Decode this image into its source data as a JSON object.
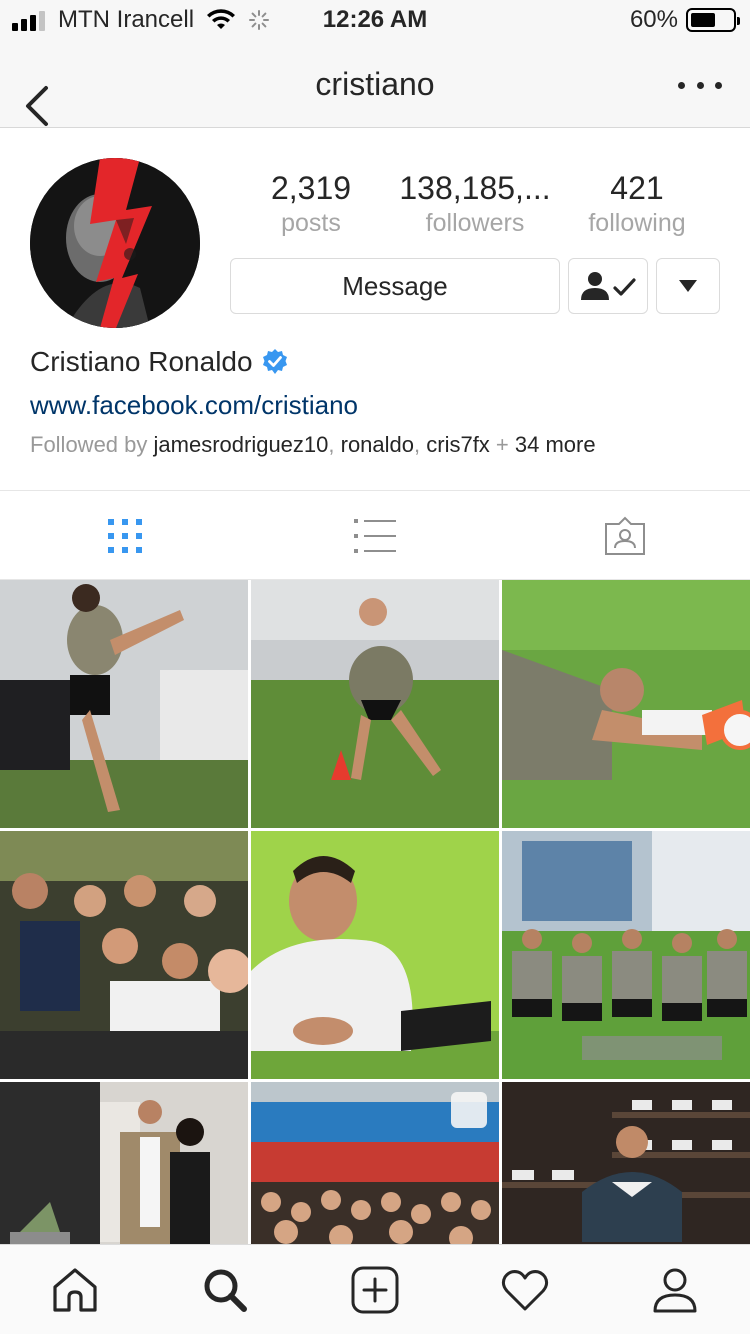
{
  "status_bar": {
    "carrier": "MTN Irancell",
    "time": "12:26 AM",
    "battery": "60%",
    "battery_level": 0.6,
    "signal_bars_filled": 3,
    "signal_bars_total": 4
  },
  "nav": {
    "title": "cristiano",
    "back_icon": "chevron-left-icon",
    "more_icon": "more-horizontal-icon"
  },
  "profile": {
    "stats": {
      "posts_count": "2,319",
      "posts_label": "posts",
      "followers_count": "138,185,...",
      "followers_label": "followers",
      "following_count": "421",
      "following_label": "following"
    },
    "message_label": "Message",
    "following_status_icon": "person-check-icon",
    "dropdown_icon": "triangle-down-icon",
    "name": "Cristiano Ronaldo",
    "verified_icon": "verified-badge-icon",
    "website": "www.facebook.com/cristiano",
    "followed_by": {
      "prefix": "Followed by ",
      "user1": "jamesrodriguez10",
      "sep1": ", ",
      "user2": "ronaldo",
      "sep2": ", ",
      "user3": "cris7fx",
      "plus": " + ",
      "more": "34 more"
    }
  },
  "tabs": {
    "grid_icon": "grid-icon",
    "list_icon": "list-icon",
    "tagged_icon": "tagged-icon",
    "active": "grid"
  },
  "colors": {
    "accent_blue": "#3897f0",
    "link": "#003569",
    "muted": "#999999",
    "text": "#262626",
    "border": "#dbdbdb"
  },
  "bottom_nav": {
    "items": [
      "home-icon",
      "search-icon",
      "add-post-icon",
      "heart-icon",
      "profile-icon"
    ],
    "active": "search-icon"
  }
}
